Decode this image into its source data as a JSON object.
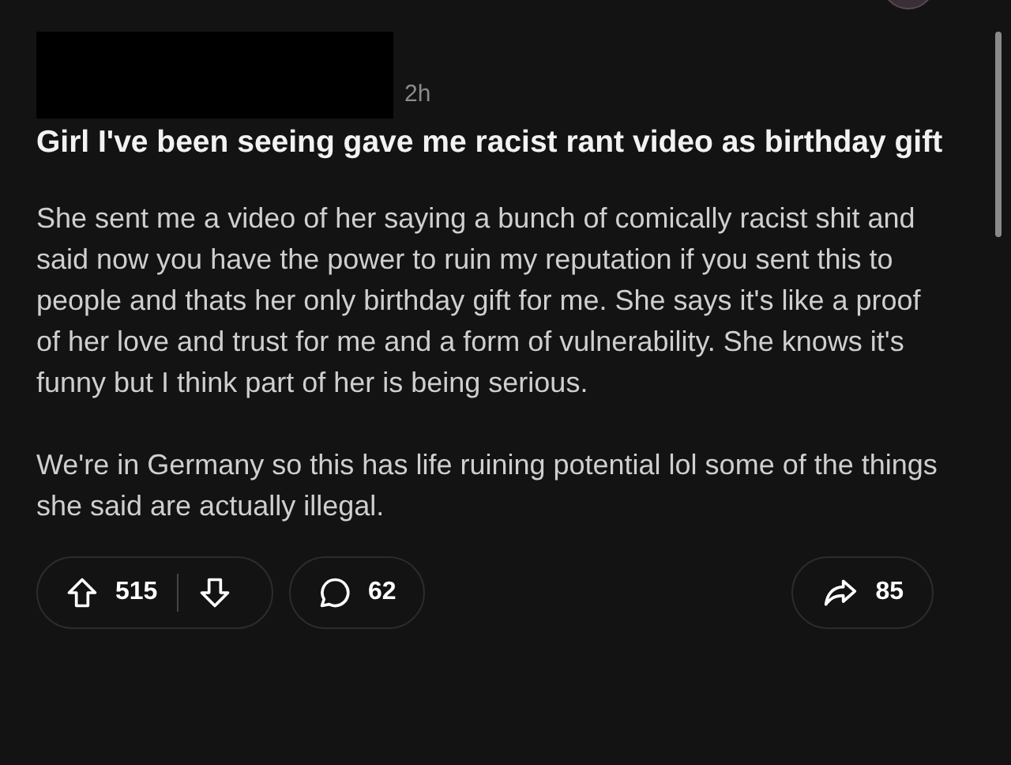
{
  "post": {
    "time": "2h",
    "title": "Girl I've been seeing gave me racist rant video as birthday gift",
    "paragraphs": [
      "She sent me a video of her saying a bunch of comically racist shit and said now you have the power to ruin my reputation if you sent this to people and thats her only birthday gift for me. She says it's like a proof of her love and trust for me and a form of vulnerability. She knows it's funny but I think part of her is being serious.",
      "We're in Germany so this has life ruining potential lol some of the things she said are actually illegal."
    ]
  },
  "actions": {
    "votes": "515",
    "comments": "62",
    "shares": "85"
  }
}
